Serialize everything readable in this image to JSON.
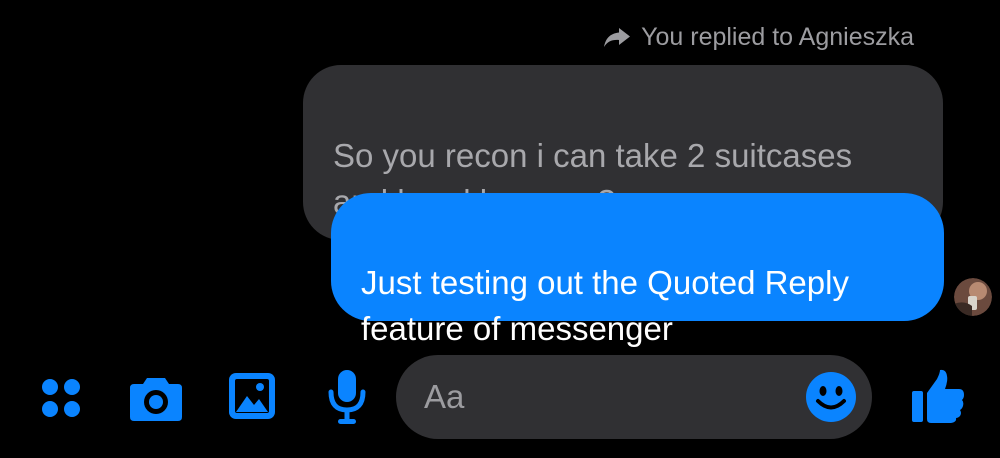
{
  "colors": {
    "accent": "#0a84ff",
    "background": "#000000",
    "received_bubble": "#303033",
    "muted_text": "#9c9ca0"
  },
  "reply_header": {
    "icon": "reply-arrow-icon",
    "text": "You replied to Agnieszka"
  },
  "quoted_message": {
    "text": "So you recon i can take 2 suitcases\nand hand luggage?"
  },
  "sent_message": {
    "text": "Just testing out the Quoted Reply\nfeature of messenger"
  },
  "read_receipt": {
    "icon": "avatar"
  },
  "composer": {
    "icons": [
      "more-options-icon",
      "camera-icon",
      "gallery-icon",
      "microphone-icon",
      "emoji-icon",
      "thumbs-up-icon"
    ],
    "input_placeholder": "Aa"
  }
}
